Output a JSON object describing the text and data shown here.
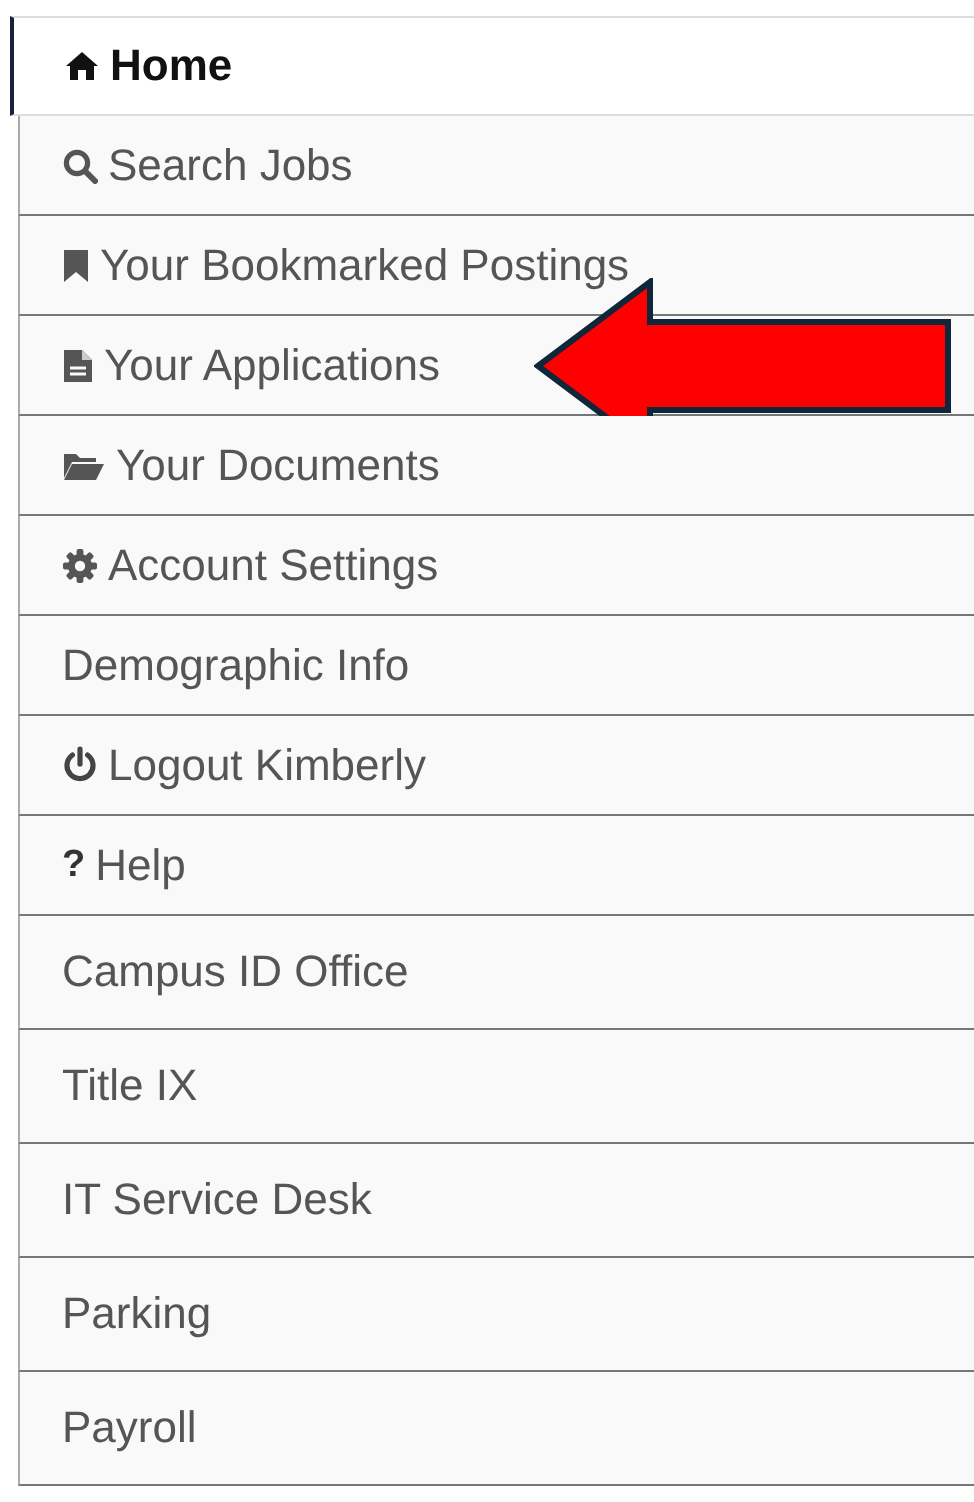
{
  "nav": [
    {
      "label": "Home",
      "kind": "home",
      "selected": true,
      "pointed": false
    },
    {
      "label": "Search Jobs",
      "kind": "search",
      "selected": false,
      "pointed": false
    },
    {
      "label": "Your Bookmarked Postings",
      "kind": "bookmark",
      "selected": false,
      "pointed": false
    },
    {
      "label": "Your Applications",
      "kind": "file",
      "selected": false,
      "pointed": true
    },
    {
      "label": "Your Documents",
      "kind": "folder",
      "selected": false,
      "pointed": false
    },
    {
      "label": "Account Settings",
      "kind": "gear",
      "selected": false,
      "pointed": false
    },
    {
      "label": "Demographic Info",
      "kind": "plain",
      "selected": false,
      "pointed": false
    },
    {
      "label": "Logout Kimberly",
      "kind": "power",
      "selected": false,
      "pointed": false
    },
    {
      "label": "Help",
      "kind": "glyph",
      "glyph": "?",
      "selected": false,
      "pointed": false
    }
  ],
  "links": [
    {
      "label": "Campus ID Office"
    },
    {
      "label": "Title IX"
    },
    {
      "label": "IT Service Desk"
    },
    {
      "label": "Parking"
    },
    {
      "label": "Payroll"
    }
  ]
}
